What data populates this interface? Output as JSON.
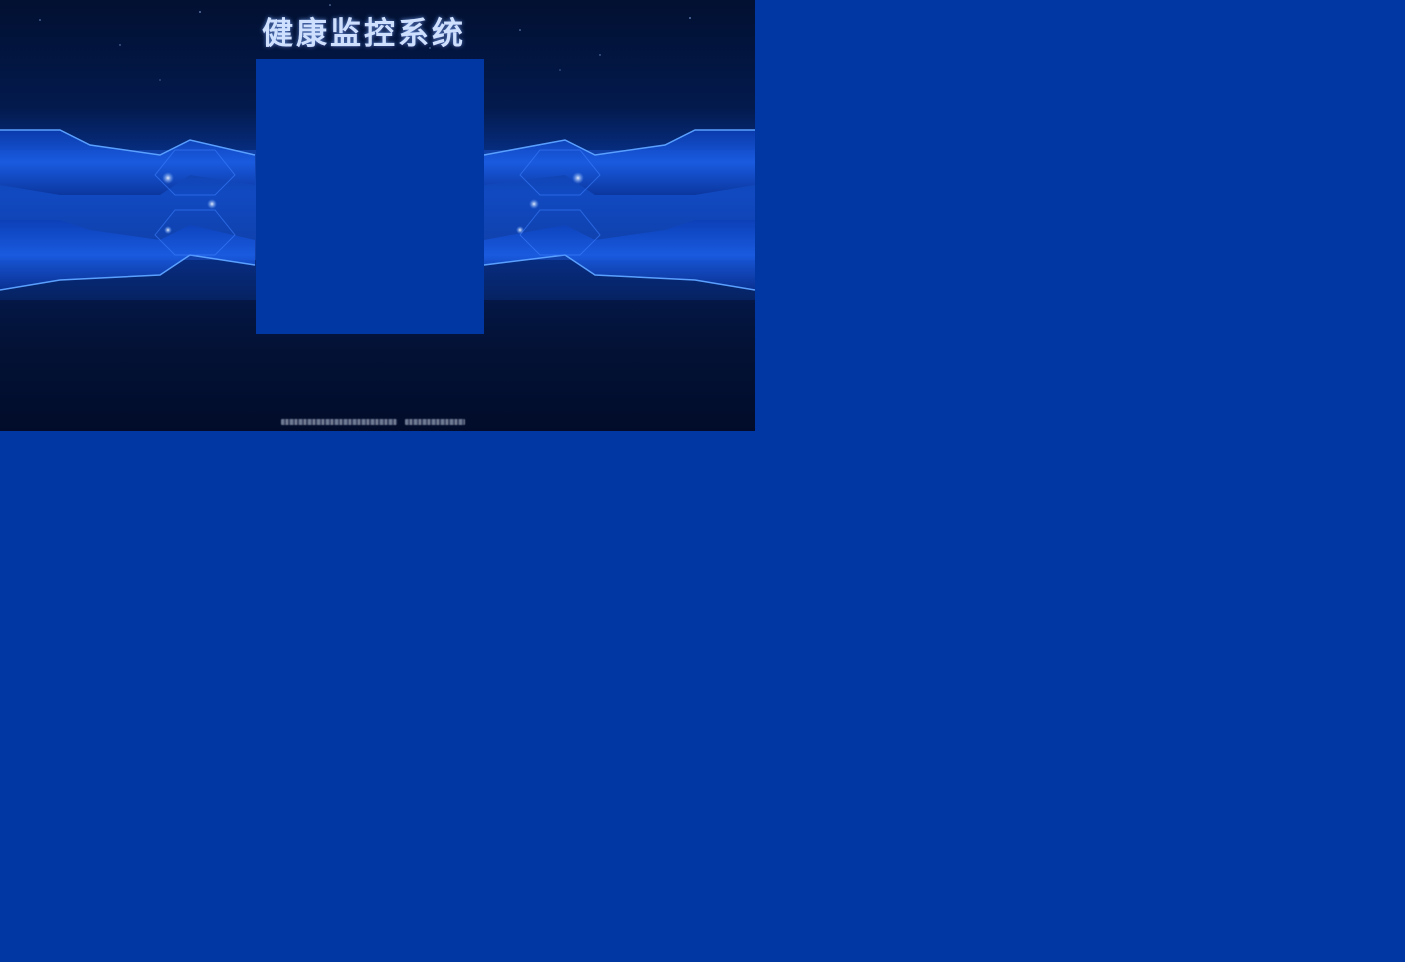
{
  "app": {
    "title": "健康监控系统"
  },
  "login_panel": {
    "background_color": "#0037a2"
  },
  "footer": {
    "copyright_text": ""
  },
  "colors": {
    "page_background": "#0037a2",
    "banner_dark": "#021031",
    "banner_accent": "#1e6cff",
    "title_color": "#cfe0ff"
  }
}
